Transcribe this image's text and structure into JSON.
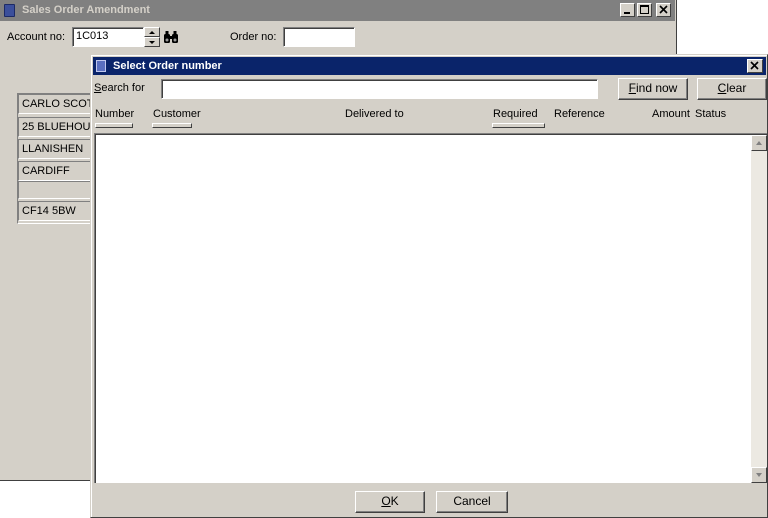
{
  "bg_window": {
    "title": "Sales Order Amendment",
    "account_label": "Account no:",
    "account_value": "1C013",
    "order_label": "Order no:",
    "order_value": "",
    "address_lines": [
      "CARLO SCOT",
      "25 BLUEHOU",
      "LLANISHEN",
      "CARDIFF",
      "",
      "CF14 5BW"
    ]
  },
  "dialog": {
    "title": "Select Order number",
    "search_label": "Search for",
    "search_value": "",
    "find_label": "Find now",
    "clear_label": "Clear",
    "columns": [
      "Number",
      "Customer",
      "Delivered to",
      "Required",
      "Reference",
      "Amount",
      "Status"
    ],
    "rows": [],
    "ok_label": "OK",
    "cancel_label": "Cancel"
  },
  "icons": {
    "window_icon": "document-icon",
    "binoculars": "binoculars-icon",
    "close": "close-icon"
  }
}
